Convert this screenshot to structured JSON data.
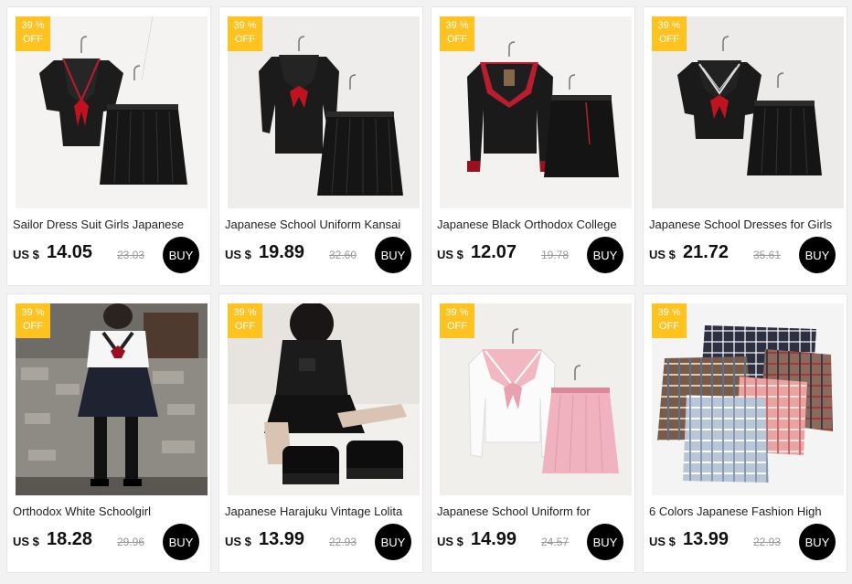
{
  "products": [
    {
      "badge_pct": "39 %",
      "badge_off": "OFF",
      "title": "Sailor Dress Suit Girls Japanese",
      "currency": "US $",
      "price": "14.05",
      "old_price": "23.03",
      "buy_label": "BUY",
      "image": "sailor-uniform-image"
    },
    {
      "badge_pct": "39 %",
      "badge_off": "OFF",
      "title": "Japanese School Uniform Kansai",
      "currency": "US $",
      "price": "19.89",
      "old_price": "32.60",
      "buy_label": "BUY",
      "image": "sailor-uniform-image"
    },
    {
      "badge_pct": "39 %",
      "badge_off": "OFF",
      "title": "Japanese Black Orthodox College",
      "currency": "US $",
      "price": "12.07",
      "old_price": "19.78",
      "buy_label": "BUY",
      "image": "sailor-uniform-image"
    },
    {
      "badge_pct": "39 %",
      "badge_off": "OFF",
      "title": "Japanese School Dresses for Girls",
      "currency": "US $",
      "price": "21.72",
      "old_price": "35.61",
      "buy_label": "BUY",
      "image": "sailor-uniform-image"
    },
    {
      "badge_pct": "39 %",
      "badge_off": "OFF",
      "title": "Orthodox White Schoolgirl",
      "currency": "US $",
      "price": "18.28",
      "old_price": "29.96",
      "buy_label": "BUY",
      "image": "model-photo-image"
    },
    {
      "badge_pct": "39 %",
      "badge_off": "OFF",
      "title": "Japanese Harajuku Vintage Lolita",
      "currency": "US $",
      "price": "13.99",
      "old_price": "22.93",
      "buy_label": "BUY",
      "image": "model-photo-image"
    },
    {
      "badge_pct": "39 %",
      "badge_off": "OFF",
      "title": "Japanese School Uniform for",
      "currency": "US $",
      "price": "14.99",
      "old_price": "24.57",
      "buy_label": "BUY",
      "image": "sailor-uniform-image"
    },
    {
      "badge_pct": "39 %",
      "badge_off": "OFF",
      "title": "6 Colors Japanese Fashion High",
      "currency": "US $",
      "price": "13.99",
      "old_price": "22.93",
      "buy_label": "BUY",
      "image": "plaid-skirts-image"
    }
  ],
  "colors": {
    "badge": "#ffc21f",
    "buy_button": "#000000",
    "price": "#111111",
    "old_price": "#999999"
  }
}
